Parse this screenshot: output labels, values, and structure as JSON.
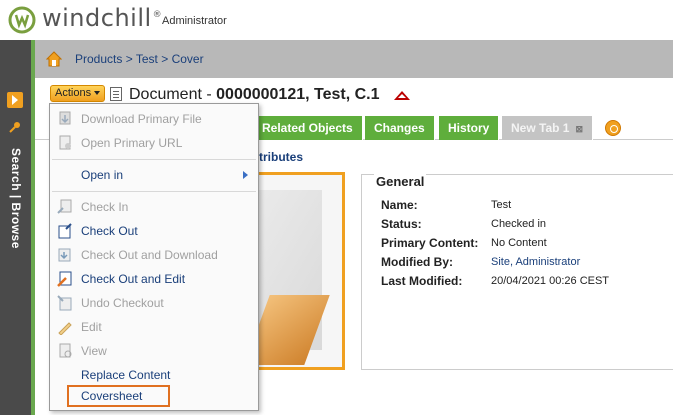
{
  "header": {
    "brand": "windchill",
    "trademark": "®",
    "user": "Administrator"
  },
  "leftbar": {
    "search_browse": "Search | Browse"
  },
  "breadcrumb": {
    "items": [
      "Products",
      "Test",
      "Cover"
    ],
    "separator": ">"
  },
  "document": {
    "prefix": "Document - ",
    "title": "0000000121, Test, C.1"
  },
  "actions": {
    "label": "Actions"
  },
  "tabs": [
    {
      "label": "Related Objects"
    },
    {
      "label": "Changes"
    },
    {
      "label": "History"
    },
    {
      "label": "New Tab 1"
    }
  ],
  "subtab": {
    "label": "ttributes"
  },
  "general": {
    "title": "General",
    "fields": [
      {
        "label": "Name:",
        "value": "Test"
      },
      {
        "label": "Status:",
        "value": "Checked in"
      },
      {
        "label": "Primary Content:",
        "value": "No Content"
      },
      {
        "label": "Modified By:",
        "value": "Site, Administrator"
      },
      {
        "label": "Last Modified:",
        "value": "20/04/2021 00:26 CEST"
      }
    ]
  },
  "menu": {
    "items": [
      {
        "label": "Download Primary File",
        "icon": "download-icon"
      },
      {
        "label": "Open Primary URL",
        "icon": "open-url-icon"
      },
      {
        "label": "Open in",
        "icon": "none"
      },
      {
        "label": "Check In",
        "icon": "check-in-icon"
      },
      {
        "label": "Check Out",
        "icon": "check-out-icon"
      },
      {
        "label": "Check Out and Download",
        "icon": "check-out-download-icon"
      },
      {
        "label": "Check Out and Edit",
        "icon": "check-out-edit-icon"
      },
      {
        "label": "Undo Checkout",
        "icon": "undo-checkout-icon"
      },
      {
        "label": "Edit",
        "icon": "edit-pencil-icon"
      },
      {
        "label": "View",
        "icon": "view-icon"
      },
      {
        "label": "Replace Content",
        "icon": "none"
      },
      {
        "label": "Coversheet",
        "icon": "none"
      }
    ]
  },
  "colors": {
    "accent": "#f0a020",
    "tab_green": "#5fae3c",
    "link": "#1a3f7a",
    "highlight": "#e07020"
  }
}
